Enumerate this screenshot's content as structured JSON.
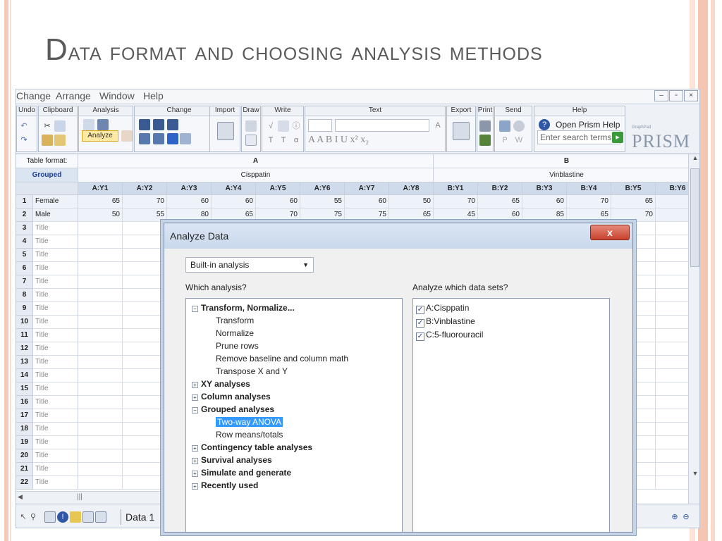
{
  "slide": {
    "title_initial": "D",
    "title_rest": "ata format and choosing analysis methods"
  },
  "menubar": [
    "Change",
    "Arrange",
    "Window",
    "Help"
  ],
  "ribbon": {
    "groups": [
      "Undo",
      "Clipboard",
      "Analysis",
      "Change",
      "Import",
      "Draw",
      "Write",
      "Text",
      "Export",
      "Print",
      "Send",
      "Help"
    ],
    "analyze_label": "Analyze",
    "help_link": "Open Prism Help",
    "search_placeholder": "Enter search terms",
    "logo_small": "GraphPad",
    "logo": "PRISM"
  },
  "sheet": {
    "table_format_label": "Table format:",
    "table_format_value": "Grouped",
    "group_a": "A",
    "group_a_name": "Cisppatin",
    "group_b": "B",
    "group_b_name": "Vinblastine",
    "columns_a": [
      "A:Y1",
      "A:Y2",
      "A:Y3",
      "A:Y4",
      "A:Y5",
      "A:Y6",
      "A:Y7",
      "A:Y8"
    ],
    "columns_b": [
      "B:Y1",
      "B:Y2",
      "B:Y3",
      "B:Y4",
      "B:Y5",
      "B:Y6"
    ],
    "rows": [
      {
        "num": "1",
        "title": "Female",
        "values": [
          "65",
          "70",
          "60",
          "60",
          "60",
          "55",
          "60",
          "50",
          "70",
          "65",
          "60",
          "70",
          "65",
          ""
        ]
      },
      {
        "num": "2",
        "title": "Male",
        "values": [
          "50",
          "55",
          "80",
          "65",
          "70",
          "75",
          "75",
          "65",
          "45",
          "60",
          "85",
          "65",
          "70",
          ""
        ]
      },
      {
        "num": "3",
        "title": "Title"
      },
      {
        "num": "4",
        "title": "Title"
      },
      {
        "num": "5",
        "title": "Title"
      },
      {
        "num": "6",
        "title": "Title"
      },
      {
        "num": "7",
        "title": "Title"
      },
      {
        "num": "8",
        "title": "Title"
      },
      {
        "num": "9",
        "title": "Title"
      },
      {
        "num": "10",
        "title": "Title"
      },
      {
        "num": "11",
        "title": "Title"
      },
      {
        "num": "12",
        "title": "Title"
      },
      {
        "num": "13",
        "title": "Title"
      },
      {
        "num": "14",
        "title": "Title"
      },
      {
        "num": "15",
        "title": "Title"
      },
      {
        "num": "16",
        "title": "Title"
      },
      {
        "num": "17",
        "title": "Title"
      },
      {
        "num": "18",
        "title": "Title"
      },
      {
        "num": "19",
        "title": "Title"
      },
      {
        "num": "20",
        "title": "Title"
      },
      {
        "num": "21",
        "title": "Title"
      },
      {
        "num": "22",
        "title": "Title"
      }
    ]
  },
  "statusbar": {
    "sheet_tab": "Data 1"
  },
  "dialog": {
    "title": "Analyze Data",
    "close_label": "x",
    "dropdown_value": "Built-in analysis",
    "which_analysis": "Which analysis?",
    "which_series": "Analyze which data sets?",
    "tree": [
      {
        "label": "Transform, Normalize...",
        "type": "cat",
        "exp": "−"
      },
      {
        "label": "Transform",
        "type": "item"
      },
      {
        "label": "Normalize",
        "type": "item"
      },
      {
        "label": "Prune rows",
        "type": "item"
      },
      {
        "label": "Remove baseline and column math",
        "type": "item"
      },
      {
        "label": "Transpose X and Y",
        "type": "item"
      },
      {
        "label": "XY analyses",
        "type": "cat",
        "exp": "+"
      },
      {
        "label": "Column analyses",
        "type": "cat",
        "exp": "+"
      },
      {
        "label": "Grouped analyses",
        "type": "cat",
        "exp": "−"
      },
      {
        "label": "Two-way ANOVA",
        "type": "item",
        "selected": true
      },
      {
        "label": "Row means/totals",
        "type": "item"
      },
      {
        "label": "Contingency table analyses",
        "type": "cat",
        "exp": "+"
      },
      {
        "label": "Survival analyses",
        "type": "cat",
        "exp": "+"
      },
      {
        "label": "Simulate and generate",
        "type": "cat",
        "exp": "+"
      },
      {
        "label": "Recently used",
        "type": "cat",
        "exp": "+"
      }
    ],
    "series": [
      "A:Cisppatin",
      "B:Vinblastine",
      "C:5-fluorouracil"
    ]
  }
}
